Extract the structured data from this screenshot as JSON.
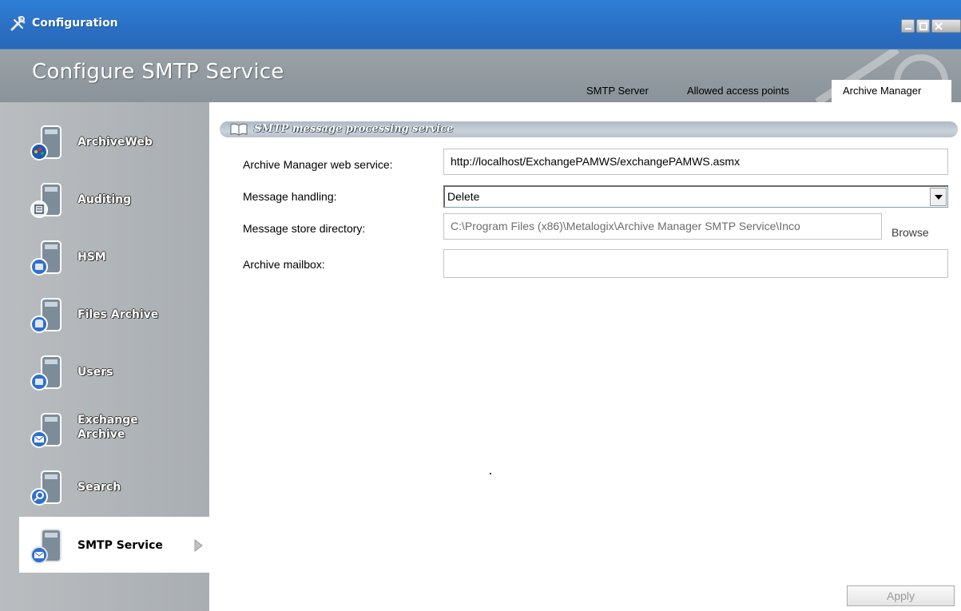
{
  "window": {
    "title": "Configuration",
    "app_icon": "tools-icon",
    "controls": [
      "minimize-icon",
      "maximize-icon",
      "close-icon"
    ]
  },
  "header": {
    "page_title": "Configure SMTP Service",
    "tabs": [
      {
        "label": "SMTP Server",
        "selected": false
      },
      {
        "label": "Allowed access points",
        "selected": false
      },
      {
        "label": "Archive Manager",
        "selected": true
      }
    ]
  },
  "sidebar": {
    "items": [
      {
        "label": "ArchiveWeb",
        "icon": "archiveweb-server-icon"
      },
      {
        "label": "Auditing",
        "icon": "auditing-server-icon"
      },
      {
        "label": "HSM",
        "icon": "hsm-server-icon"
      },
      {
        "label": "Files Archive",
        "icon": "files-archive-server-icon"
      },
      {
        "label": "Users",
        "icon": "users-server-icon"
      },
      {
        "label": "Exchange Archive",
        "label_line1": "Exchange",
        "label_line2": "Archive",
        "icon": "exchange-archive-server-icon"
      },
      {
        "label": "Search",
        "icon": "search-server-icon"
      },
      {
        "label": "SMTP Service",
        "icon": "smtp-server-icon",
        "active": true
      }
    ]
  },
  "main": {
    "group_title": "SMTP message processing service",
    "fields": {
      "web_service_label": "Archive Manager web service:",
      "web_service_value": "http://localhost/ExchangePAMWS/exchangePAMWS.asmx",
      "message_handling_label": "Message handling:",
      "message_handling_value": "Delete",
      "store_dir_label": "Message store directory:",
      "store_dir_value": "C:\\Program Files (x86)\\Metalogix\\Archive Manager SMTP Service\\Inco",
      "browse_label": "Browse",
      "mailbox_label": "Archive mailbox:",
      "mailbox_value": ""
    },
    "apply_label": "Apply"
  }
}
